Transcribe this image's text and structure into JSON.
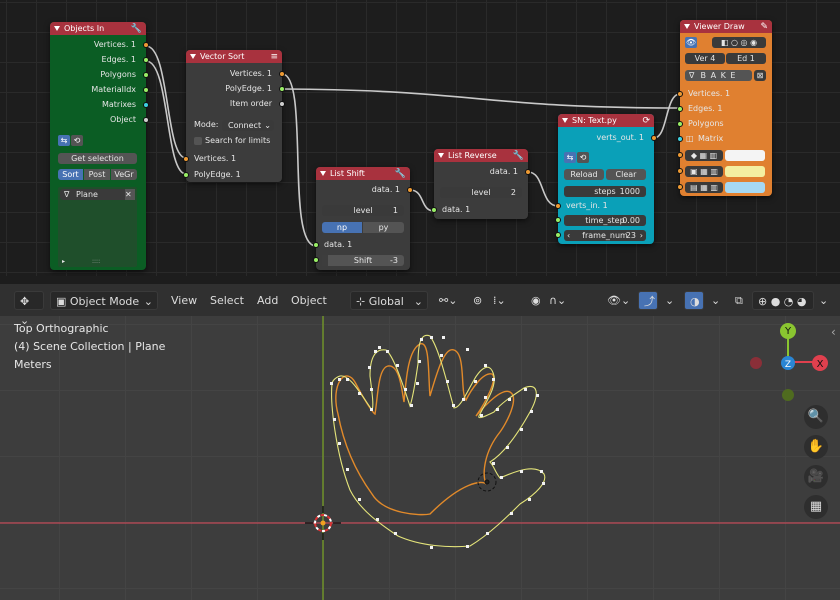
{
  "colors": {
    "green_node": "#0b5d24",
    "red_header": "#a8323e",
    "teal_node": "#0aa0b8",
    "orange_node": "#e08030",
    "socket_orange": "#ee9a33",
    "socket_green": "#99ee66",
    "socket_cyan": "#3ed0e0"
  },
  "objects_in": {
    "title": "Objects In",
    "outputs": [
      "Vertices. 1",
      "Edges. 1",
      "Polygons",
      "MaterialIdx",
      "Matrixes",
      "Object"
    ],
    "get_selection": "Get selection",
    "tabs": [
      "Sort",
      "Post",
      "VeGr"
    ],
    "object_name": "Plane",
    "footer": "::::"
  },
  "vector_sort": {
    "title": "Vector Sort",
    "outputs": [
      "Vertices. 1",
      "PolyEdge. 1",
      "Item order"
    ],
    "mode_label": "Mode:",
    "mode_value": "Connect",
    "search_limits": "Search for limits",
    "inputs": [
      "Vertices. 1",
      "PolyEdge. 1"
    ]
  },
  "list_shift": {
    "title": "List Shift",
    "output": "data. 1",
    "level_label": "level",
    "level_value": "1",
    "np": "np",
    "py": "py",
    "input": "data. 1",
    "shift_label": "Shift",
    "shift_value": "-3"
  },
  "list_reverse": {
    "title": "List Reverse",
    "output": "data. 1",
    "level_label": "level",
    "level_value": "2",
    "input": "data. 1"
  },
  "sn_text": {
    "title": "SN: Text.py",
    "output": "verts_out. 1",
    "reload": "Reload",
    "clear": "Clear",
    "steps_label": "steps",
    "steps_value": "1000",
    "input": "verts_in. 1",
    "time_step_label": "time_step",
    "time_step_value": "0.00",
    "frame_num_label": "frame_num",
    "frame_num_value": "23"
  },
  "viewer_draw": {
    "title": "Viewer Draw",
    "ver": "Ver",
    "ver_value": "4",
    "ed": "Ed",
    "ed_value": "1",
    "bake": "B A K E",
    "inputs": [
      "Vertices. 1",
      "Edges. 1",
      "Polygons",
      "Matrix"
    ],
    "swatches": [
      "#f4f4f4",
      "#f4efa0",
      "#a6d8f2"
    ]
  },
  "viewport": {
    "mode": "Object Mode",
    "menus": [
      "View",
      "Select",
      "Add",
      "Object"
    ],
    "transform": "Global",
    "view_name": "Top Orthographic",
    "collection": "(4) Scene Collection | Plane",
    "units": "Meters",
    "axes": {
      "x": "X",
      "y": "Y",
      "z": "Z"
    }
  }
}
